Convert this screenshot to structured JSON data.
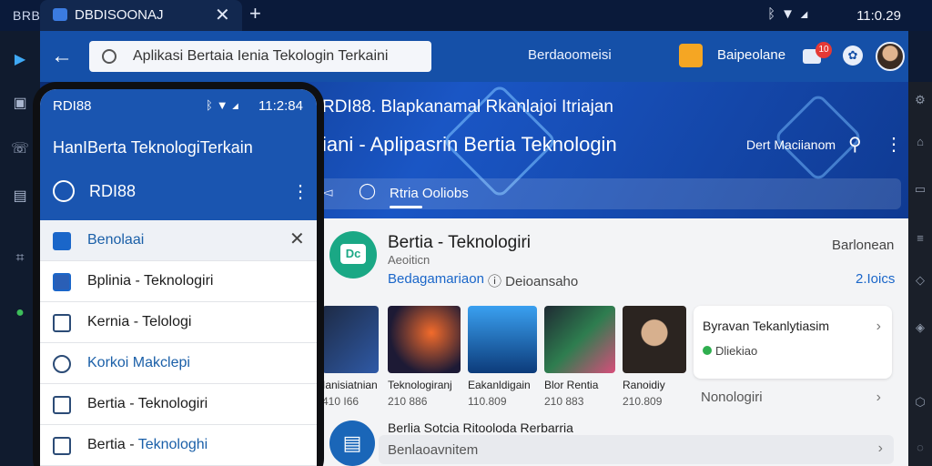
{
  "os": {
    "app_name": "BRBII",
    "tab_title": "DBDISOONAJ",
    "time": "11:0.29"
  },
  "toolbar": {
    "url_text": "Aplikasi Bertaia Ienia Tekologin Terkaini",
    "center_label": "Berdaoomeisi",
    "label": "Baipeolane",
    "notification_count": "10"
  },
  "hero": {
    "title_line1": "RDI88. Blapkanamal Rkanlajoi Itriajan",
    "title_line2": "iani - Aplipasrin Bertia Teknologin",
    "right_label": "Dert Maciianom",
    "tab_label": "Rtria Ooliobs"
  },
  "app": {
    "title": "Bertia - Teknologiri",
    "subtitle": "Aeoiticn",
    "link": "Bedagamariaon",
    "count": "Deioansaho",
    "count_icon": "1",
    "right_label": "Barlonean",
    "right_value": "2.Ioics"
  },
  "thumbnails": [
    {
      "t1": "Ianisiatnian",
      "t2": "410 I66"
    },
    {
      "t1": "Teknologiranj",
      "t2": "210 886"
    },
    {
      "t1": "Eakanldigain",
      "t2": "110.809"
    },
    {
      "t1": "Blor Rentia",
      "t2": "210 883"
    },
    {
      "t1": "Ranoidiy",
      "t2": "210.809"
    }
  ],
  "side_card": {
    "title": "Byravan Tekanlytiasim",
    "status": "Dliekiao",
    "row_label": "Nonologiri"
  },
  "item2": {
    "title": "Berlia Sotcia Ritooloda Rerbarria",
    "bar_label": "Benlaoavnitem"
  },
  "phone": {
    "carrier": "RDI88",
    "time": "11:2:84",
    "header_title": "HanIBerta TeknologiTerkain",
    "sub_label": "RDI88",
    "rows": [
      {
        "label": "Benolaai"
      },
      {
        "label": "Bplinia - Teknologiri"
      },
      {
        "label": "Kernia - Telologi"
      },
      {
        "label": "Korkoi Makclepi"
      },
      {
        "label": "Bertia - Teknologiri"
      },
      {
        "label_a": "Bertia - ",
        "label_b": "Teknologhi"
      }
    ]
  },
  "colors": {
    "accent_blue": "#1550a8",
    "hero_blue": "#1a56c5",
    "green_logo": "#1aa885",
    "notif_red": "#e53935"
  },
  "icons": [
    "back-arrow-icon",
    "search-icon",
    "more-vert-icon",
    "close-icon",
    "plus-icon",
    "bluetooth-icon",
    "wifi-icon",
    "signal-icon",
    "chevron-right-icon"
  ]
}
